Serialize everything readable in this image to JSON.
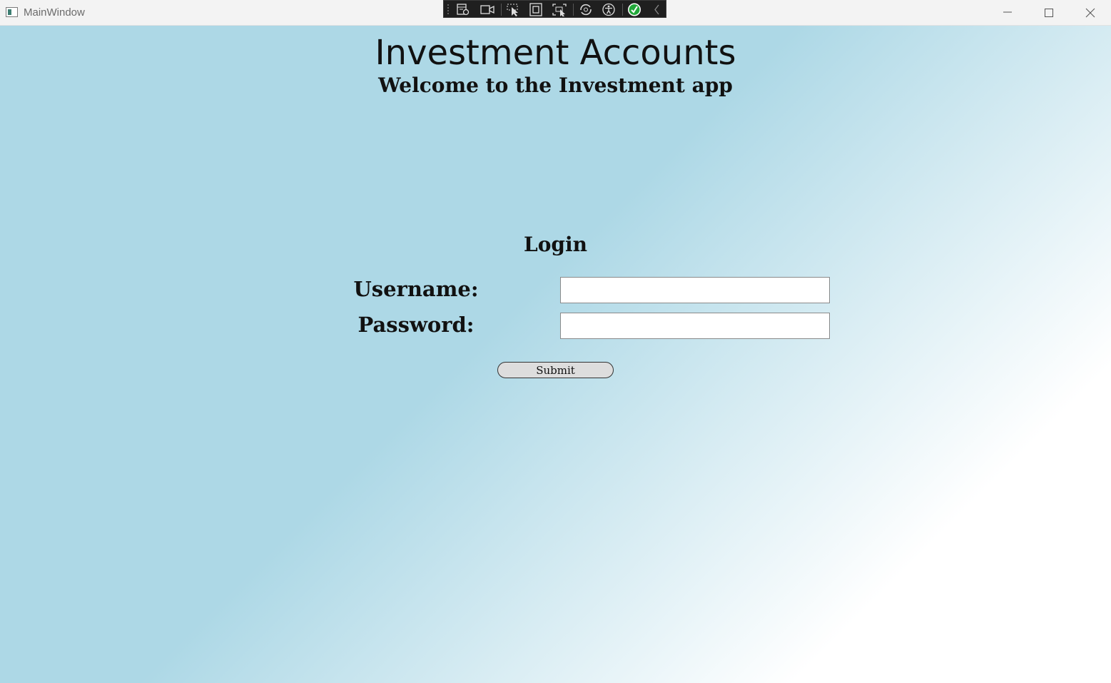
{
  "window": {
    "title": "MainWindow"
  },
  "devtools": {
    "icons": [
      "live-visual-tree-icon",
      "record-icon",
      "select-element-icon",
      "display-layout-adorners-icon",
      "track-focused-element-icon",
      "hot-reload-icon",
      "accessibility-icon",
      "binding-check-icon",
      "collapse-toolbar-icon"
    ]
  },
  "header": {
    "title": "Investment Accounts",
    "subtitle": "Welcome to the Investment app"
  },
  "login": {
    "title": "Login",
    "username_label": "Username:",
    "username_value": "",
    "password_label": "Password:",
    "password_value": "",
    "submit_label": "Submit"
  },
  "colors": {
    "background_start": "#add8e6",
    "background_end": "#ffffff",
    "check_green": "#22a83a"
  }
}
